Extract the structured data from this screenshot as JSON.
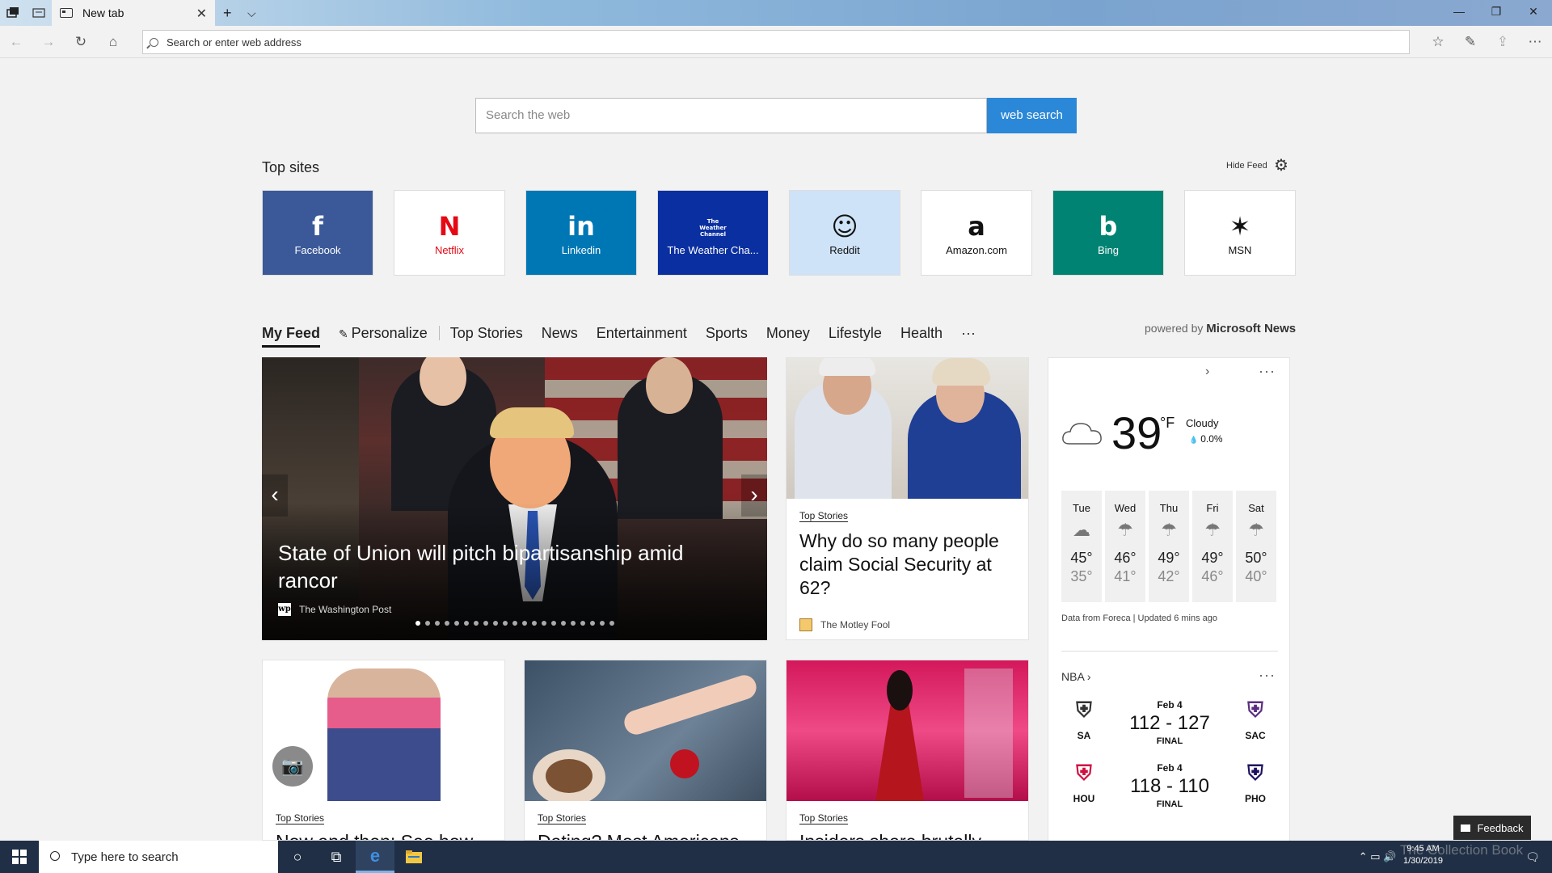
{
  "browser": {
    "tab_title": "New tab",
    "address_placeholder": "Search or enter web address"
  },
  "search": {
    "placeholder": "Search the web",
    "button": "web search"
  },
  "top_sites": {
    "heading": "Top sites",
    "hide_feed": "Hide Feed",
    "items": [
      {
        "label": "Facebook",
        "glyph": "f",
        "bg": "#3b5998",
        "fg": "#ffffff"
      },
      {
        "label": "Netflix",
        "glyph": "N",
        "bg": "#ffffff",
        "fg": "#e50914"
      },
      {
        "label": "Linkedin",
        "glyph": "in",
        "bg": "#0077b5",
        "fg": "#ffffff"
      },
      {
        "label": "The Weather Cha...",
        "glyph": "The Weather Channel",
        "bg": "#0a2fa0",
        "fg": "#ffffff"
      },
      {
        "label": "Reddit",
        "glyph": "☺",
        "bg": "#cee3f8",
        "fg": "#111111"
      },
      {
        "label": "Amazon.com",
        "glyph": "a",
        "bg": "#ffffff",
        "fg": "#111111"
      },
      {
        "label": "Bing",
        "glyph": "b",
        "bg": "#008373",
        "fg": "#ffffff"
      },
      {
        "label": "MSN",
        "glyph": "✶",
        "bg": "#ffffff",
        "fg": "#111111"
      }
    ]
  },
  "feed_nav": {
    "items": [
      "My Feed",
      "Personalize",
      "Top Stories",
      "News",
      "Entertainment",
      "Sports",
      "Money",
      "Lifestyle",
      "Health",
      "···"
    ],
    "powered_prefix": "powered by",
    "powered_brand": "Microsoft News"
  },
  "hero": {
    "title": "State of Union will pitch bipartisanship amid rancor",
    "source": "The Washington Post",
    "source_logo": "wp",
    "slide_count": 21,
    "active_slide": 1
  },
  "card_social_security": {
    "category": "Top Stories",
    "title": "Why do so many people claim Social Security at 62?",
    "source": "The Motley Fool"
  },
  "bottom_cards": [
    {
      "category": "Top Stories",
      "title": "Now and then: See how"
    },
    {
      "category": "Top Stories",
      "title": "Dating? Most Americans"
    },
    {
      "category": "Top Stories",
      "title": "Insiders share brutally"
    }
  ],
  "weather": {
    "temp": "39",
    "unit": "°F",
    "condition": "Cloudy",
    "precip": "0.0%",
    "forecast": [
      {
        "day": "Tue",
        "hi": "45°",
        "lo": "35°",
        "icon": "cloud"
      },
      {
        "day": "Wed",
        "hi": "46°",
        "lo": "41°",
        "icon": "rain"
      },
      {
        "day": "Thu",
        "hi": "49°",
        "lo": "42°",
        "icon": "rain"
      },
      {
        "day": "Fri",
        "hi": "49°",
        "lo": "46°",
        "icon": "rain"
      },
      {
        "day": "Sat",
        "hi": "50°",
        "lo": "40°",
        "icon": "rain"
      }
    ],
    "footer": "Data from Foreca | Updated 6 mins ago"
  },
  "nba": {
    "heading": "NBA",
    "games": [
      {
        "date": "Feb 4",
        "score": "112 - 127",
        "status": "FINAL",
        "home": "SA",
        "away": "SAC",
        "home_color": "#333333",
        "away_color": "#5a2d81"
      },
      {
        "date": "Feb 4",
        "score": "118 - 110",
        "status": "FINAL",
        "home": "HOU",
        "away": "PHO",
        "home_color": "#ce1141",
        "away_color": "#1d1160"
      }
    ]
  },
  "feedback": "Feedback",
  "taskbar": {
    "search_placeholder": "Type here to search",
    "time": "9:45 AM",
    "date": "1/30/2019"
  },
  "watermark": "The Collection Book",
  "colors": {
    "accent": "#2b88d8",
    "taskbar": "#202f45"
  }
}
